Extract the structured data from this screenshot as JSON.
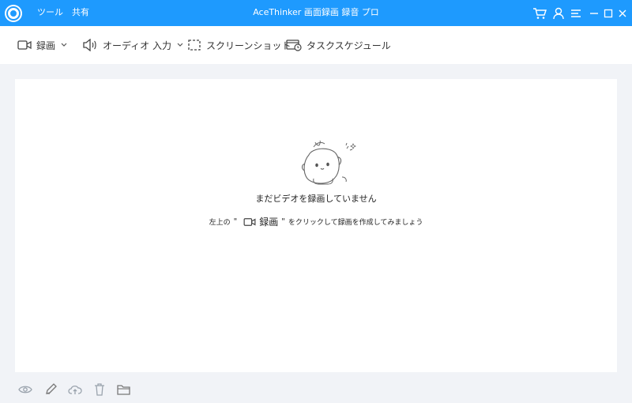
{
  "titlebar": {
    "title": "AceThinker 画面録画 録音 プロ",
    "menu": [
      "ツール",
      "共有"
    ],
    "bg_color": "#1e9afe",
    "icons": [
      "cart-icon",
      "user-icon",
      "menu-icon",
      "minimize-icon",
      "maximize-icon",
      "close-icon"
    ]
  },
  "toolbar": {
    "record": {
      "label": "録画",
      "icon": "camera-icon"
    },
    "audio": {
      "label": "オーディオ 入力",
      "icon": "speaker-icon"
    },
    "screenshot": {
      "label": "スクリーンショット",
      "icon": "crop-icon"
    },
    "schedule": {
      "label": "タスクスケジュール",
      "icon": "schedule-icon"
    }
  },
  "empty_state": {
    "title": "まだビデオを録画していません",
    "hint_prefix": "左上の",
    "quote_open": "\"",
    "hint_record_label": "録画",
    "quote_close": "\"",
    "hint_suffix": "をクリックして録画を作成してみましょう"
  },
  "bottom_actions": [
    "preview-icon",
    "edit-icon",
    "upload-icon",
    "delete-icon",
    "folder-icon"
  ]
}
